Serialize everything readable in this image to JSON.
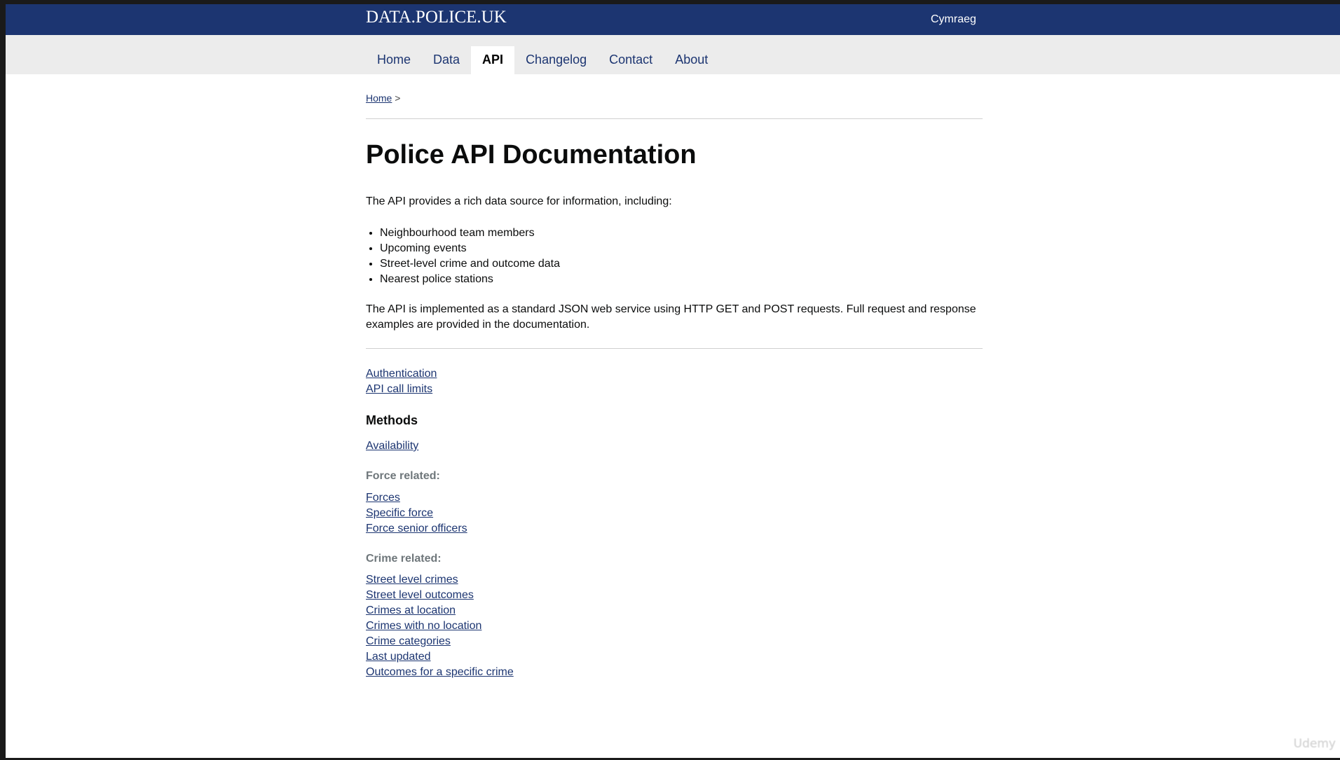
{
  "header": {
    "logo_text": "DATA.POLICE.UK",
    "language_link": "Cymraeg"
  },
  "nav": {
    "items": [
      {
        "label": "Home",
        "active": false
      },
      {
        "label": "Data",
        "active": false
      },
      {
        "label": "API",
        "active": true
      },
      {
        "label": "Changelog",
        "active": false
      },
      {
        "label": "Contact",
        "active": false
      },
      {
        "label": "About",
        "active": false
      }
    ]
  },
  "breadcrumb": {
    "home_label": "Home",
    "separator": ">"
  },
  "main": {
    "title": "Police API Documentation",
    "intro": "The API provides a rich data source for information, including:",
    "features": [
      "Neighbourhood team members",
      "Upcoming events",
      "Street-level crime and outcome data",
      "Nearest police stations"
    ],
    "description": "The API is implemented as a standard JSON web service using HTTP GET and POST requests. Full request and response examples are provided in the documentation.",
    "general_links": [
      "Authentication",
      "API call limits"
    ],
    "methods_heading": "Methods",
    "availability_link": "Availability",
    "force_heading": "Force related:",
    "force_links": [
      "Forces",
      "Specific force",
      "Force senior officers"
    ],
    "crime_heading": "Crime related:",
    "crime_links": [
      "Street level crimes",
      "Street level outcomes",
      "Crimes at location",
      "Crimes with no location",
      "Crime categories",
      "Last updated",
      "Outcomes for a specific crime"
    ]
  },
  "watermark": "Udemy",
  "colors": {
    "header_bg": "#1c3571",
    "nav_bg": "#ececec",
    "link": "#1c3571",
    "subheading": "#6f777b"
  }
}
